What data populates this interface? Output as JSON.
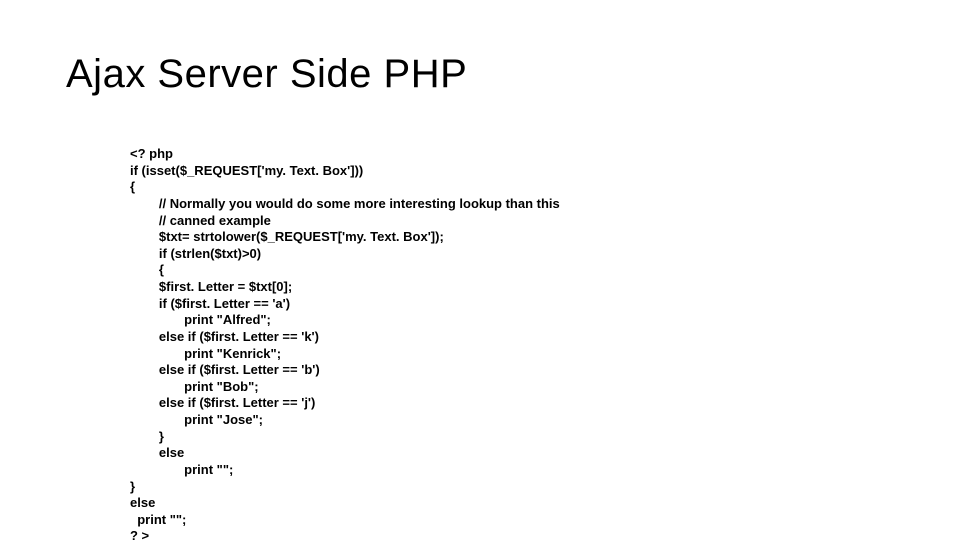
{
  "title": "Ajax Server Side PHP",
  "code": "<? php\nif (isset($_REQUEST['my. Text. Box']))\n{\n        // Normally you would do some more interesting lookup than this\n        // canned example\n        $txt= strtolower($_REQUEST['my. Text. Box']);\n        if (strlen($txt)>0)\n        {\n        $first. Letter = $txt[0];\n        if ($first. Letter == 'a')\n               print \"Alfred\";\n        else if ($first. Letter == 'k')\n               print \"Kenrick\";\n        else if ($first. Letter == 'b')\n               print \"Bob\";\n        else if ($first. Letter == 'j')\n               print \"Jose\";\n        }\n        else\n               print \"\";\n}\nelse\n  print \"\";\n? >"
}
